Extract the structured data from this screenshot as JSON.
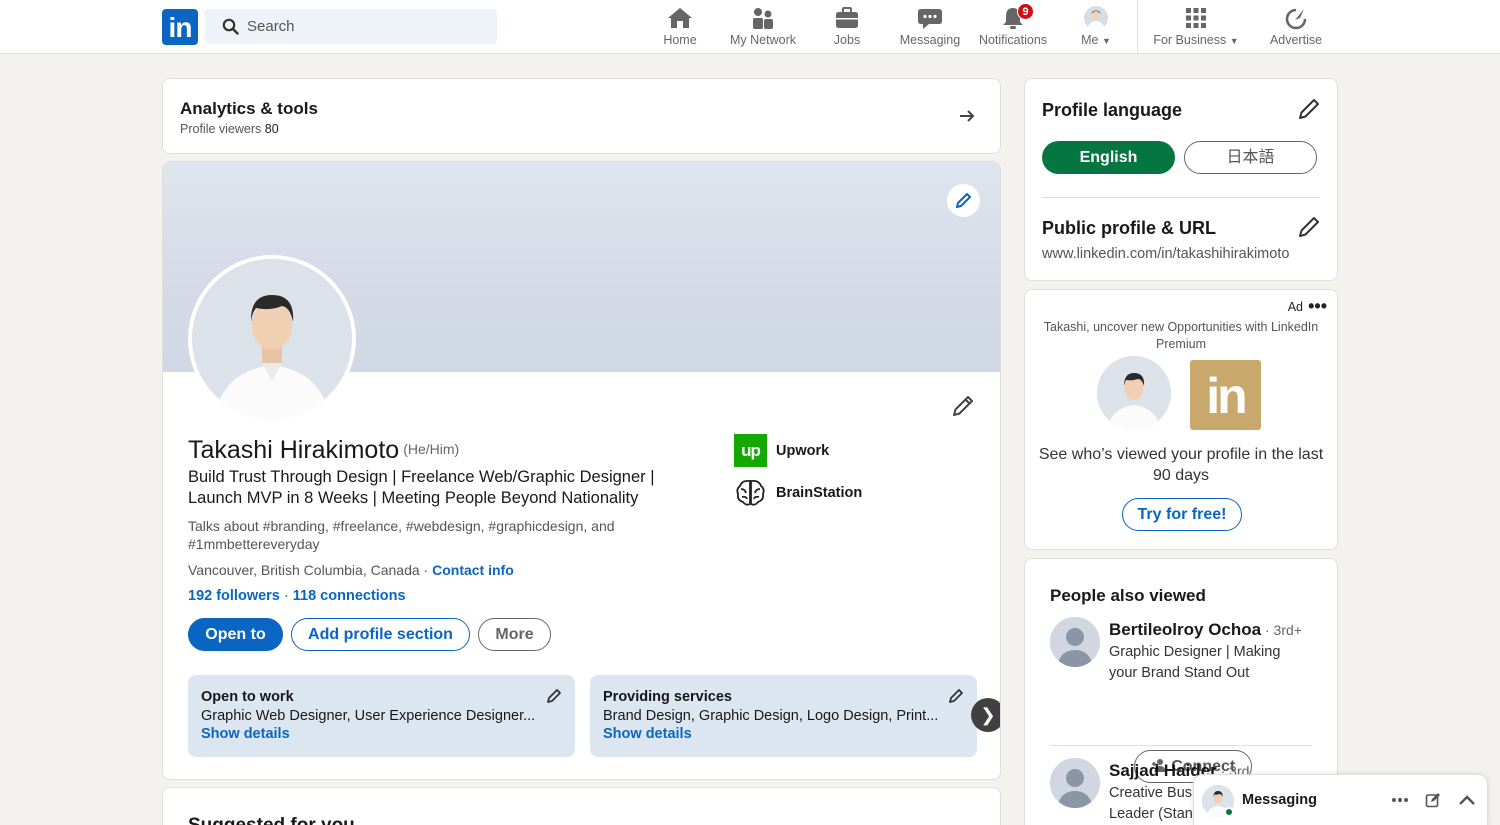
{
  "nav": {
    "search_placeholder": "Search",
    "items": [
      {
        "label": "Home",
        "icon": "home-icon"
      },
      {
        "label": "My Network",
        "icon": "network-icon"
      },
      {
        "label": "Jobs",
        "icon": "briefcase-icon"
      },
      {
        "label": "Messaging",
        "icon": "chat-icon"
      },
      {
        "label": "Notifications",
        "icon": "bell-icon",
        "badge": "9"
      },
      {
        "label": "Me",
        "icon": "avatar"
      },
      {
        "label": "For Business",
        "icon": "grid-icon"
      },
      {
        "label": "Advertise",
        "icon": "compass-icon"
      }
    ],
    "logo_text": "in"
  },
  "analytics": {
    "title": "Analytics & tools",
    "subtitle": "Profile viewers",
    "viewers": "80"
  },
  "profile": {
    "name": "Takashi Hirakimoto",
    "pronouns": "(He/Him)",
    "headline": "Build Trust Through Design | Freelance Web/Graphic Designer | Launch MVP in 8 Weeks | Meeting People Beyond Nationality",
    "talks": "Talks about #branding, #freelance, #webdesign, #graphicdesign, and #1mmbettereveryday",
    "location": "Vancouver, British Columbia, Canada",
    "location_sep": " · ",
    "contact_info": "Contact info",
    "followers": "192 followers",
    "stats_sep": " · ",
    "connections": "118 connections",
    "buttons": {
      "open_to": "Open to",
      "add_section": "Add profile section",
      "more": "More"
    },
    "companies": [
      {
        "name": "Upwork",
        "logo_text": "up"
      },
      {
        "name": "BrainStation"
      }
    ],
    "cards": [
      {
        "title": "Open to work",
        "desc": "Graphic Web Designer, User Experience Designer...",
        "link": "Show details"
      },
      {
        "title": "Providing services",
        "desc": "Brand Design, Graphic Design, Logo Design, Print...",
        "link": "Show details"
      }
    ],
    "carousel_next": "❯"
  },
  "suggested": {
    "title": "Suggested for you"
  },
  "profile_language": {
    "title": "Profile language",
    "active": "English",
    "other": "日本語"
  },
  "public_profile": {
    "title": "Public profile & URL",
    "url": "www.linkedin.com/in/takashihirakimoto"
  },
  "ad": {
    "label": "Ad",
    "dots": "•••",
    "text": "Takashi, uncover new Opportunities with LinkedIn Premium",
    "brand_text": "in",
    "main": "See who’s viewed your profile in the last 90 days",
    "cta": "Try for free!"
  },
  "people_also_viewed": {
    "title": "People also viewed",
    "people": [
      {
        "name": "Bertileolroy Ochoa",
        "degree": " · 3rd+",
        "headline": "Graphic Designer | Making your Brand Stand Out",
        "action": "Connect"
      },
      {
        "name": "Sajjad Haider",
        "degree": " · 3rd",
        "headline": "Creative Business Leader (Stan"
      }
    ]
  },
  "messaging": {
    "title": "Messaging"
  },
  "colors": {
    "brand": "#0a66c2",
    "open_to_work_green": "#057642",
    "background": "#f3f2ef"
  }
}
